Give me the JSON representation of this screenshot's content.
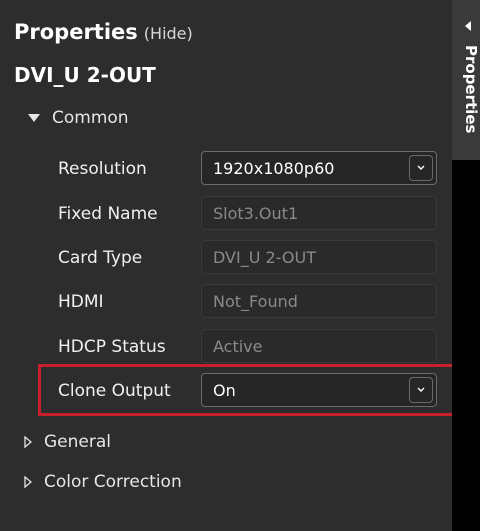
{
  "header": {
    "title": "Properties",
    "hide_label": "(Hide)"
  },
  "device": {
    "name": "DVI_U 2-OUT"
  },
  "sections": {
    "common": "Common",
    "general": "General",
    "color_correction": "Color Correction"
  },
  "properties": [
    {
      "label": "Resolution",
      "value": "1920x1080p60",
      "type": "dropdown"
    },
    {
      "label": "Fixed Name",
      "value": "Slot3.Out1",
      "type": "readonly"
    },
    {
      "label": "Card Type",
      "value": "DVI_U 2-OUT",
      "type": "readonly"
    },
    {
      "label": "HDMI",
      "value": "Not_Found",
      "type": "readonly"
    },
    {
      "label": "HDCP Status",
      "value": "Active",
      "type": "readonly"
    },
    {
      "label": "Clone Output",
      "value": "On",
      "type": "dropdown"
    }
  ],
  "side_tab": {
    "label": "Properties"
  },
  "colors": {
    "highlight": "#c8202a",
    "panel_bg": "#2d2d2d"
  }
}
